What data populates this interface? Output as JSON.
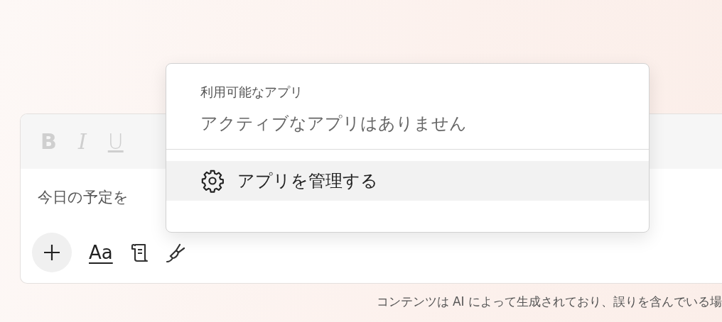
{
  "composer": {
    "format_buttons": [
      {
        "label": "B",
        "kind": "bold",
        "disabled": true
      },
      {
        "label": "I",
        "kind": "italic",
        "disabled": true
      },
      {
        "label": "U",
        "kind": "underline",
        "disabled": true
      }
    ],
    "placeholder": "今日の予定を",
    "tools": [
      {
        "kind": "add"
      },
      {
        "kind": "text",
        "label": "Aa"
      },
      {
        "kind": "scroll"
      },
      {
        "kind": "plug"
      }
    ]
  },
  "apps_menu": {
    "heading": "利用可能なアプリ",
    "empty_message": "アクティブなアプリはありません",
    "items": [
      {
        "label": "アプリを管理する",
        "kind": "settings",
        "selected": true
      }
    ]
  },
  "footer": "コンテンツは AI によって生成されており、誤りを含んでいる場"
}
